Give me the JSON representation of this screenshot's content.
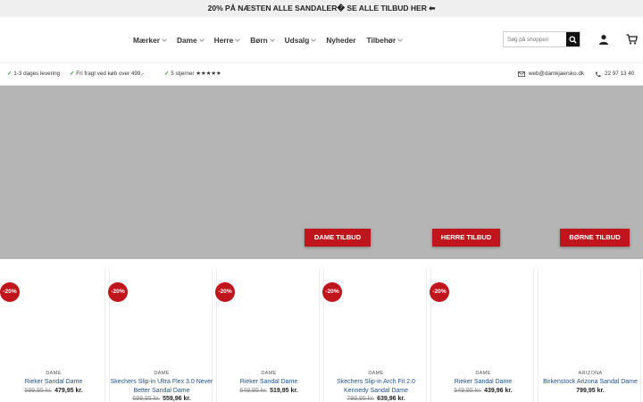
{
  "promo": {
    "text": "20% PÅ NÆSTEN ALLE SANDALER� SE ALLE TILBUD HER ⬅"
  },
  "nav": {
    "items": [
      {
        "label": "Mærker",
        "dropdown": true
      },
      {
        "label": "Dame",
        "dropdown": true
      },
      {
        "label": "Herre",
        "dropdown": true
      },
      {
        "label": "Børn",
        "dropdown": true
      },
      {
        "label": "Udsalg",
        "dropdown": true
      },
      {
        "label": "Nyheder",
        "dropdown": false
      },
      {
        "label": "Tilbehør",
        "dropdown": true
      }
    ]
  },
  "search": {
    "placeholder": "Søg på shoppen"
  },
  "usp": {
    "delivery": "1-3 dages levering",
    "freight": "Fri fragt ved køb over 499,-",
    "rating": "5 stjerner ★★★★★"
  },
  "contact": {
    "email": "web@damkjaersko.dk",
    "phone": "22 97 13 40"
  },
  "hero": {
    "buttons": {
      "dame": "DAME TILBUD",
      "herre": "HERRE TILBUD",
      "borne": "BØRNE TILBUD"
    }
  },
  "products": [
    {
      "badge": "-20%",
      "brand": "DAME",
      "name": "Rieker Sandal Dame",
      "old_price": "599,95 kr.",
      "price": "479,95 kr."
    },
    {
      "badge": "-20%",
      "brand": "DAME",
      "name": "Skechers Slip-in Ultra Flex 3.0 Never Better Sandal Dame",
      "old_price": "699,95 kr.",
      "price": "559,96 kr."
    },
    {
      "badge": "-20%",
      "brand": "DAME",
      "name": "Rieker Sandal Dame",
      "old_price": "649,95 kr.",
      "price": "519,95 kr."
    },
    {
      "badge": "-20%",
      "brand": "DAME",
      "name": "Skechers Slip-in Arch Fit 2.0 Kennedy Sandal Dame",
      "old_price": "799,95 kr.",
      "price": "639,96 kr."
    },
    {
      "badge": "-20%",
      "brand": "DAME",
      "name": "Rieker Sandal Dame",
      "old_price": "549,95 kr.",
      "price": "439,96 kr."
    },
    {
      "badge": "",
      "brand": "ARIZONA",
      "name": "Birkenstock Arizona Sandal Dame",
      "old_price": "",
      "price": "799,95 kr."
    }
  ],
  "colors": {
    "accent": "#c0151c",
    "hero_bg": "#b5b5b5",
    "link": "#1e4f8a",
    "check": "#3a9a3a"
  },
  "icons": [
    "search-icon",
    "account-icon",
    "cart-icon",
    "mail-icon",
    "phone-icon",
    "check-icon",
    "chevron-down-icon"
  ]
}
